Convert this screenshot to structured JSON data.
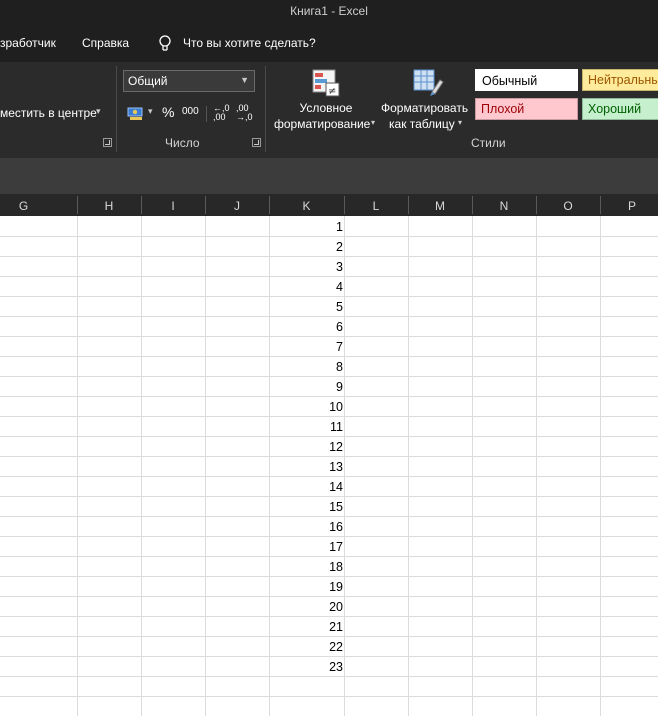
{
  "window": {
    "title": "Книга1  -  Excel"
  },
  "tabs": {
    "developer": "зработчик",
    "help": "Справка",
    "tell_me": "Что вы хотите сделать?"
  },
  "ribbon": {
    "alignment": {
      "merge_center": "местить в центре"
    },
    "number": {
      "group_label": "Число",
      "format_value": "Общий",
      "percent": "%",
      "thousands": "000",
      "increase_decimal": "←,0 ,00",
      "decrease_decimal": ",00 →,0"
    },
    "styles": {
      "group_label": "Стили",
      "conditional_line1": "Условное",
      "conditional_line2": "форматирование",
      "table_line1": "Форматировать",
      "table_line2": "как таблицу",
      "normal": "Обычный",
      "neutral": "Нейтральны",
      "bad": "Плохой",
      "good": "Хороший",
      "colors": {
        "normal_bg": "#ffffff",
        "neutral_bg": "#ffeb9c",
        "neutral_fg": "#9c5700",
        "bad_bg": "#ffc7ce",
        "bad_fg": "#9c0006",
        "good_bg": "#c6efce",
        "good_fg": "#006100"
      }
    }
  },
  "columns": [
    "G",
    "H",
    "I",
    "J",
    "K",
    "L",
    "M",
    "N",
    "O",
    "P"
  ],
  "cells_k": [
    "1",
    "2",
    "3",
    "4",
    "5",
    "6",
    "7",
    "8",
    "9",
    "10",
    "11",
    "12",
    "13",
    "14",
    "15",
    "16",
    "17",
    "18",
    "19",
    "20",
    "21",
    "22",
    "23"
  ]
}
